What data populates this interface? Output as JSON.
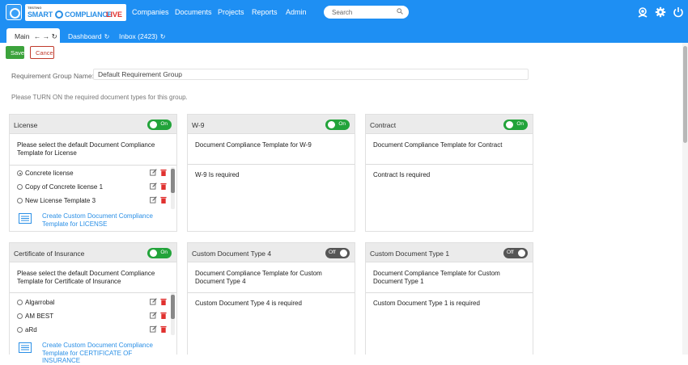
{
  "brand": {
    "small_text": "TESTING",
    "smart": "SMART",
    "compliance": "COMPLIANCE",
    "live": "LIVE"
  },
  "nav": {
    "items": [
      "Companies",
      "Documents",
      "Projects",
      "Reports",
      "Admin"
    ]
  },
  "search": {
    "placeholder": "Search"
  },
  "tabs": {
    "main": "Main",
    "dashboard": "Dashboard",
    "inbox": "Inbox (2423)"
  },
  "actions": {
    "save": "Save",
    "cancel": "Cancel"
  },
  "form": {
    "group_name_label": "Requirement Group Name:",
    "group_name_value": "Default Requirement Group",
    "instruction": "Please TURN ON the required document types for this group."
  },
  "cards": [
    {
      "title": "License",
      "toggle": "On",
      "prompt": "Please select the default Document Compliance Template for License",
      "options": [
        {
          "label": "Concrete license",
          "checked": true
        },
        {
          "label": "Copy of Concrete license 1",
          "checked": false
        },
        {
          "label": "New License Template 3",
          "checked": false
        }
      ],
      "create_link": "Create Custom Document Compliance Template for LICENSE"
    },
    {
      "title": "W-9",
      "toggle": "On",
      "prompt": "Document Compliance Template for W-9",
      "required": "W-9 Is required"
    },
    {
      "title": "Contract",
      "toggle": "On",
      "prompt": "Document Compliance Template for Contract",
      "required": "Contract Is required"
    },
    {
      "title": "Certificate of Insurance",
      "toggle": "On",
      "prompt": "Please select the default Document Compliance Template for Certificate of Insurance",
      "options": [
        {
          "label": "Algarrobal",
          "checked": false
        },
        {
          "label": "AM BEST",
          "checked": false
        },
        {
          "label": "aRd",
          "checked": false
        }
      ],
      "create_link": "Create Custom Document Compliance Template for CERTIFICATE OF INSURANCE"
    },
    {
      "title": "Custom Document Type 4",
      "toggle": "Off",
      "prompt": "Document Compliance Template for Custom Document Type 4",
      "required": "Custom Document Type 4 is required"
    },
    {
      "title": "Custom Document Type 1",
      "toggle": "Off",
      "prompt": "Document Compliance Template for Custom Document Type 1",
      "required": "Custom Document Type 1 is required"
    }
  ],
  "colors": {
    "primary": "#1e8ff3",
    "toggle_on": "#22a33a",
    "toggle_off": "#555555",
    "save": "#3ca33c",
    "cancel": "#c0392b",
    "delete_icon": "#e0312f",
    "link": "#2a8fe6"
  },
  "icons": {
    "logo": "logo-icon",
    "search": "search-icon",
    "support": "support-agent-icon",
    "settings": "gear-icon",
    "power": "power-icon",
    "edit": "edit-icon",
    "delete": "trash-icon",
    "document": "document-list-icon"
  }
}
